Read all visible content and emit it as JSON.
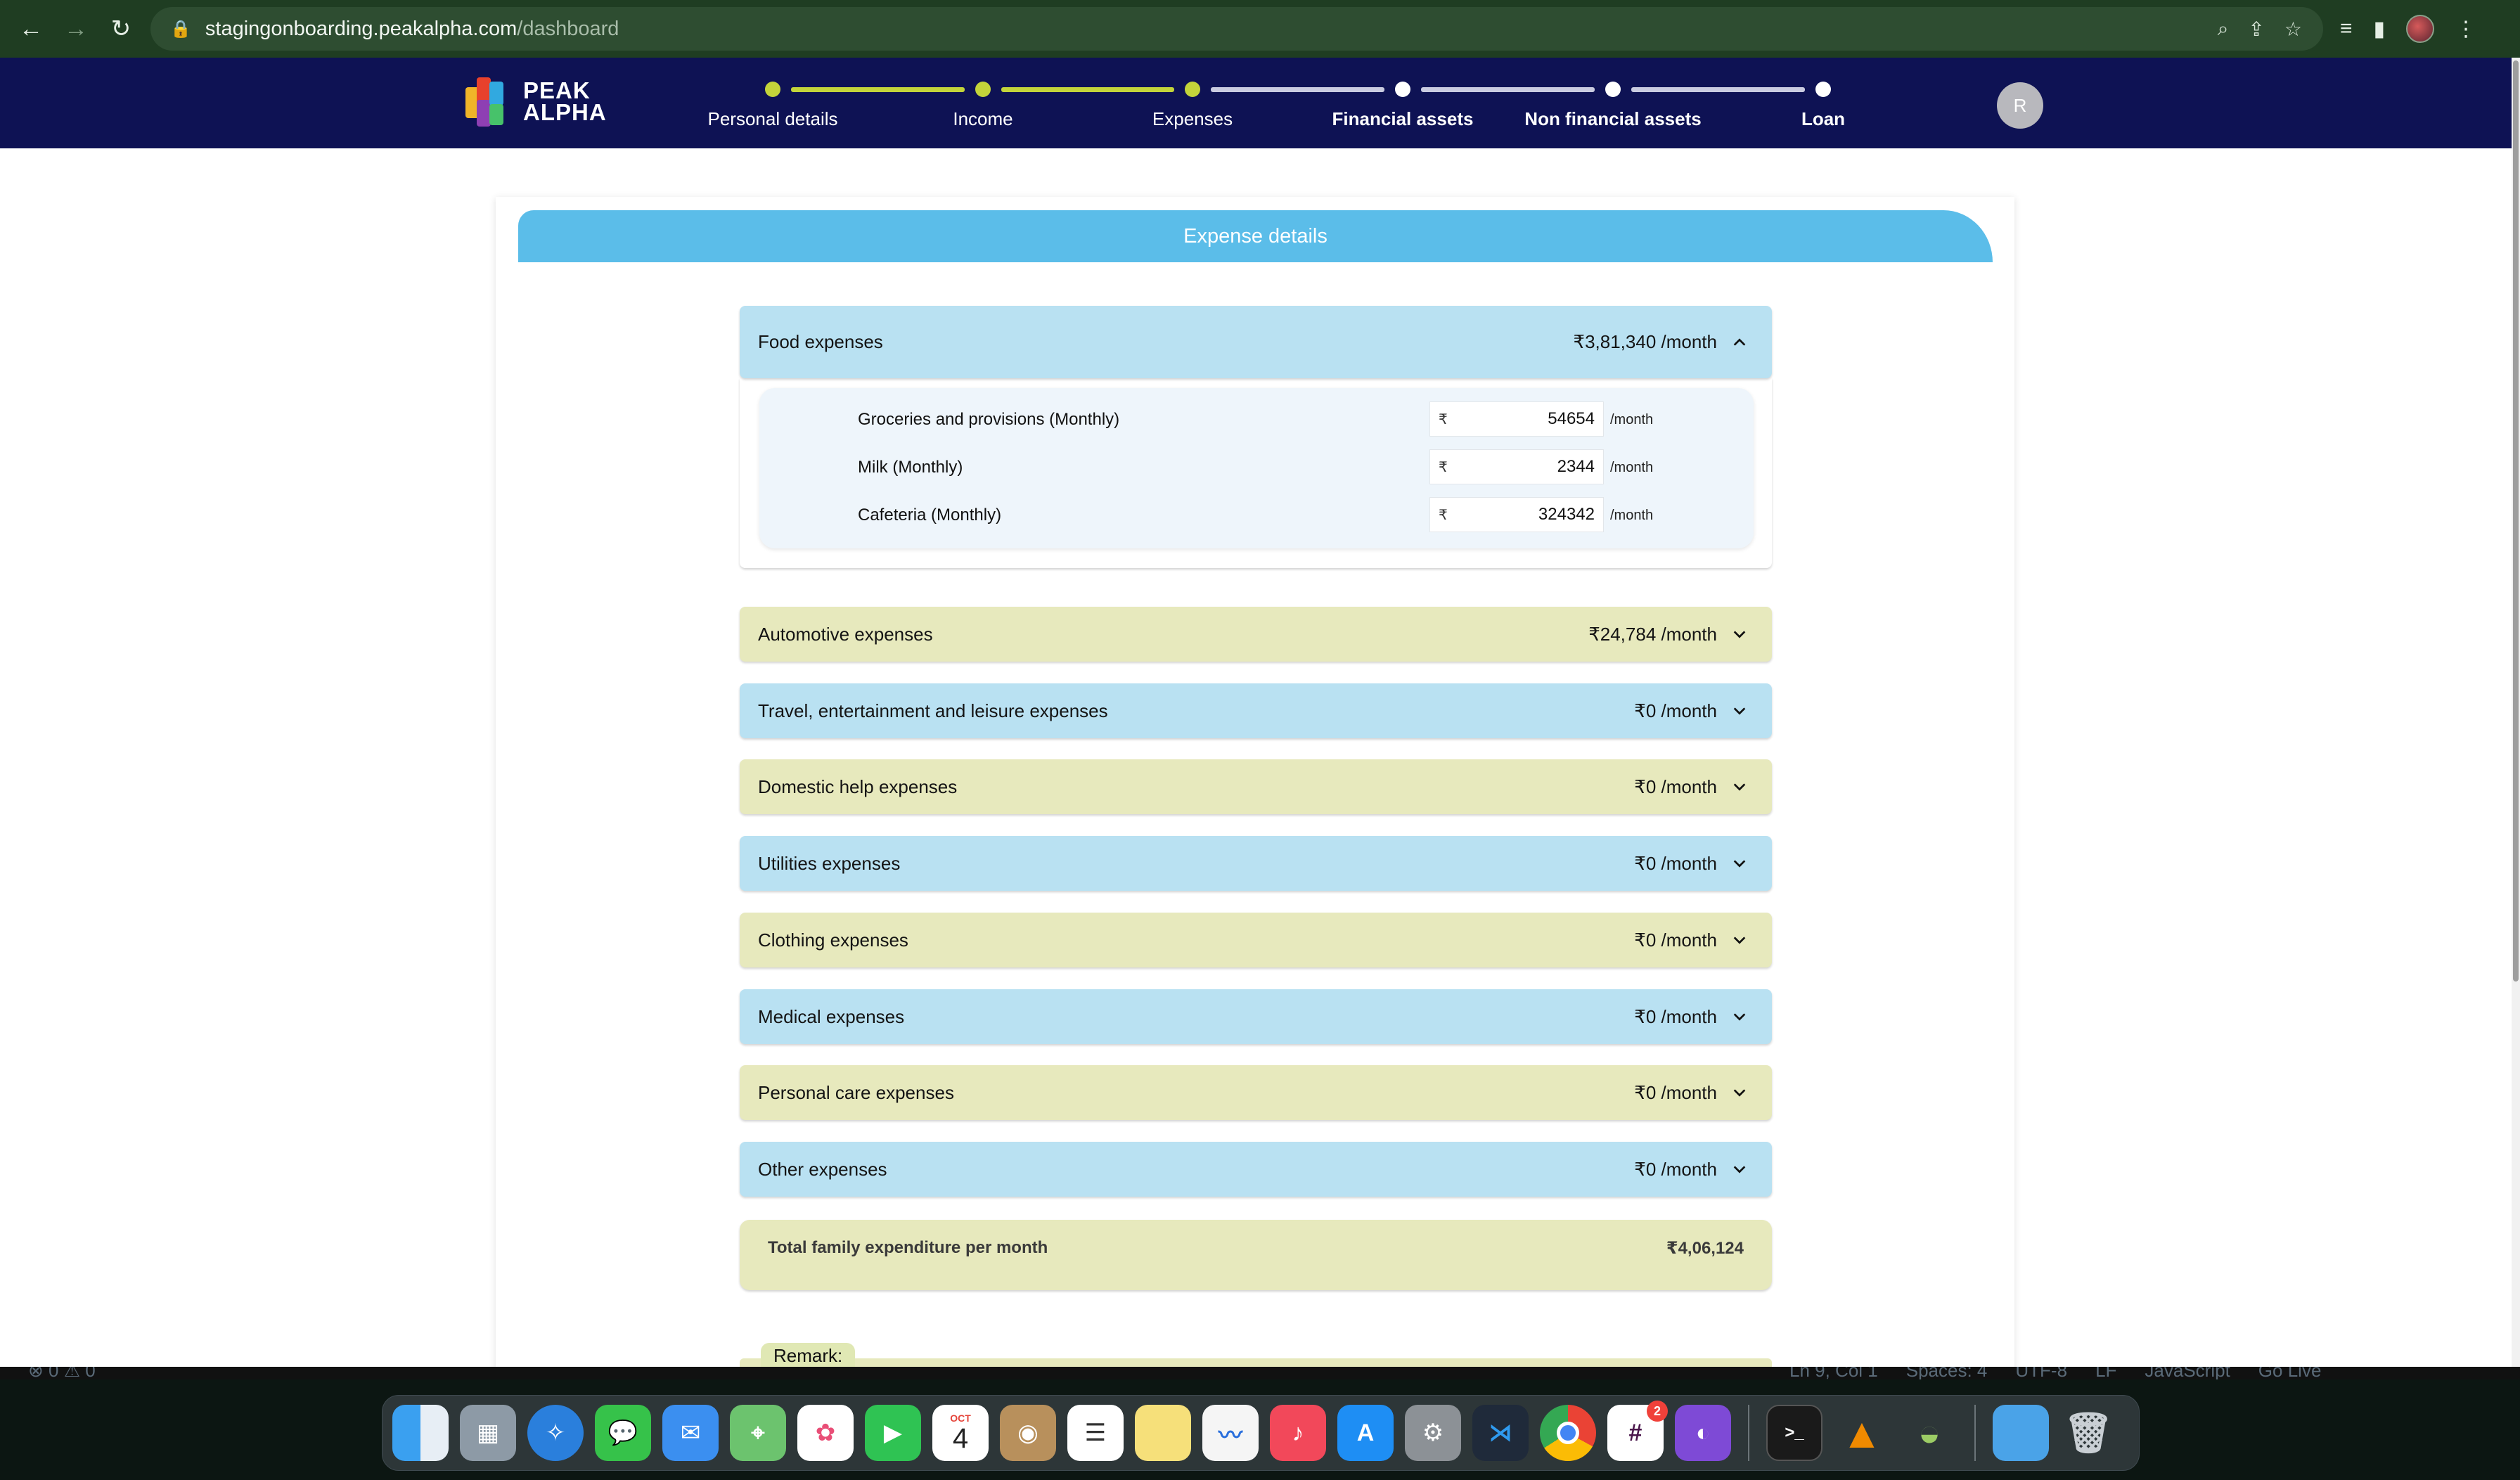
{
  "browser": {
    "url_domain": "stagingonboarding.peakalpha.com",
    "url_path": "/dashboard"
  },
  "header": {
    "logo_line1": "PEAK",
    "logo_line2": "ALPHA",
    "avatar_initial": "R",
    "steps": [
      {
        "label": "Personal details",
        "state": "done"
      },
      {
        "label": "Income",
        "state": "done"
      },
      {
        "label": "Expenses",
        "state": "active"
      },
      {
        "label": "Financial assets",
        "state": "pending"
      },
      {
        "label": "Non financial assets",
        "state": "pending"
      },
      {
        "label": "Loan",
        "state": "pending"
      }
    ]
  },
  "colors": {
    "header_bg": "#0e1254",
    "step_done": "#c3d43a",
    "step_pending": "#ffffff",
    "banner": "#5bbde9",
    "accordion_blue": "#b9e1f2",
    "accordion_green": "#e7e9bd"
  },
  "main": {
    "section_title": "Expense details",
    "food": {
      "label": "Food expenses",
      "amount": "₹3,81,340 /month",
      "items": [
        {
          "label": "Groceries and provisions (Monthly)",
          "currency": "₹",
          "value": "54654",
          "unit": "/month"
        },
        {
          "label": "Milk (Monthly)",
          "currency": "₹",
          "value": "2344",
          "unit": "/month"
        },
        {
          "label": "Cafeteria (Monthly)",
          "currency": "₹",
          "value": "324342",
          "unit": "/month"
        }
      ]
    },
    "categories": [
      {
        "label": "Automotive expenses",
        "amount": "₹24,784 /month"
      },
      {
        "label": "Travel, entertainment and leisure expenses",
        "amount": "₹0 /month"
      },
      {
        "label": "Domestic help expenses",
        "amount": "₹0 /month"
      },
      {
        "label": "Utilities expenses",
        "amount": "₹0 /month"
      },
      {
        "label": "Clothing expenses",
        "amount": "₹0 /month"
      },
      {
        "label": "Medical expenses",
        "amount": "₹0 /month"
      },
      {
        "label": "Personal care expenses",
        "amount": "₹0 /month"
      },
      {
        "label": "Other expenses",
        "amount": "₹0 /month"
      }
    ],
    "total_label": "Total family expenditure per month",
    "total_value": "₹4,06,124",
    "remark_label": "Remark:"
  },
  "status_bar": {
    "problems": "⊗ 0 ⚠ 0",
    "position": "Ln 9, Col 1",
    "spaces": "Spaces: 4",
    "encoding": "UTF-8",
    "eol": "LF",
    "language": "JavaScript",
    "go_live": "Go Live"
  },
  "dock": {
    "calendar_month": "OCT",
    "calendar_day": "4",
    "slack_badge": "2",
    "apps": [
      "finder-icon",
      "launchpad-icon",
      "safari-icon",
      "messages-icon",
      "mail-icon",
      "maps-icon",
      "photos-icon",
      "facetime-icon",
      "calendar-icon",
      "contacts-icon",
      "reminders-icon",
      "notes-icon",
      "freeform-icon",
      "music-icon",
      "app-store-icon",
      "system-settings-icon",
      "vscode-icon",
      "chrome-icon",
      "slack-icon",
      "github-desktop-icon",
      "terminal-icon",
      "vlc-icon",
      "android-studio-icon",
      "folder-icon",
      "trash-icon"
    ]
  }
}
